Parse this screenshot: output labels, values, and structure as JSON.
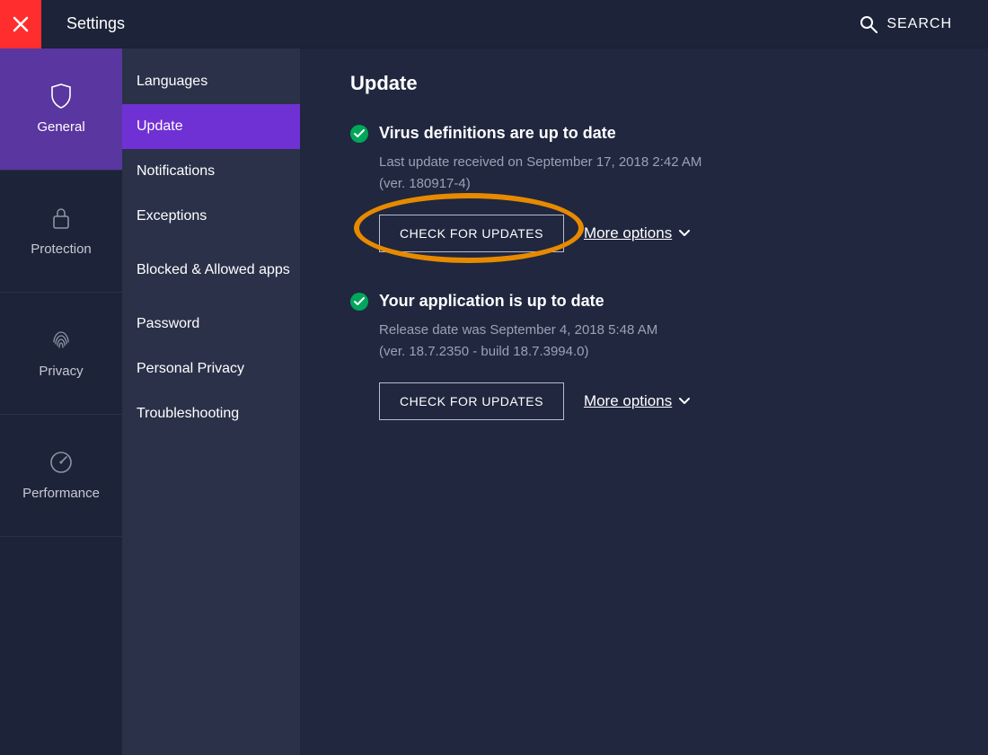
{
  "topbar": {
    "title": "Settings",
    "search_label": "SEARCH"
  },
  "categories": [
    {
      "label": "General"
    },
    {
      "label": "Protection"
    },
    {
      "label": "Privacy"
    },
    {
      "label": "Performance"
    }
  ],
  "subnav": [
    {
      "label": "Languages"
    },
    {
      "label": "Update"
    },
    {
      "label": "Notifications"
    },
    {
      "label": "Exceptions"
    },
    {
      "label": "Blocked & Allowed apps"
    },
    {
      "label": "Password"
    },
    {
      "label": "Personal Privacy"
    },
    {
      "label": "Troubleshooting"
    }
  ],
  "main": {
    "page_title": "Update",
    "virus": {
      "title": "Virus definitions are up to date",
      "line1": "Last update received on September 17, 2018 2:42 AM",
      "line2": "(ver. 180917-4)",
      "button": "CHECK FOR UPDATES",
      "more": "More options"
    },
    "app": {
      "title": "Your application is up to date",
      "line1": "Release date was September 4, 2018 5:48 AM",
      "line2": "(ver. 18.7.2350 - build 18.7.3994.0)",
      "button": "CHECK FOR UPDATES",
      "more": "More options"
    }
  }
}
